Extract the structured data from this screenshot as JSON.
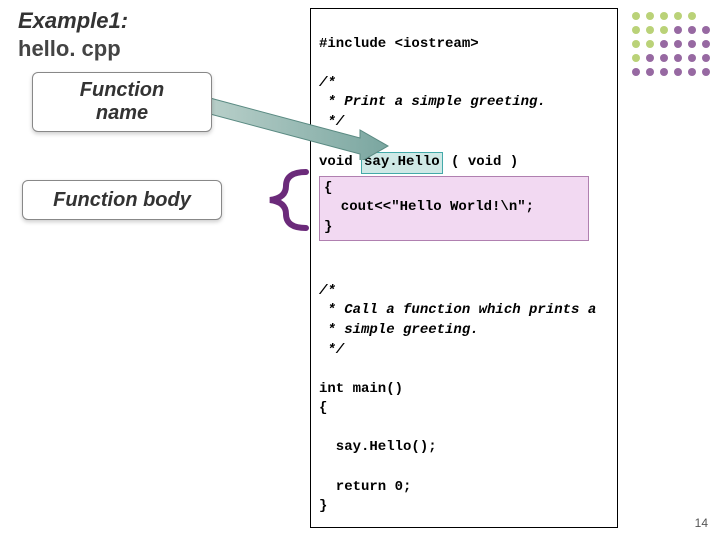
{
  "title": "Example1:",
  "subtitle": "hello. cpp",
  "labels": {
    "function_name": "Function\nname",
    "function_body": "Function body"
  },
  "code": {
    "l1": "#include <iostream>",
    "l2": "",
    "l3": "/*",
    "l4": " * Print a simple greeting.",
    "l5": " */",
    "l6": "",
    "l7a": "void ",
    "fn": "say.Hello",
    "l7b": " ( void )",
    "body_open": "{",
    "body_line": "  cout<<\"Hello World!\\n\";",
    "body_close": "}",
    "l8": "",
    "l9": "/*",
    "l10": " * Call a function which prints a",
    "l11": " * simple greeting.",
    "l12": " */",
    "l13": "",
    "l14": "int main()",
    "l15": "{",
    "l16": "",
    "l17": "  say.Hello();",
    "l18": "",
    "l19": "  return 0;",
    "l20": "}"
  },
  "pagenum": "14",
  "colors": {
    "arrow": "#7aa6a0",
    "brace": "#6b2a7a",
    "dots_green": "#9cbf3f",
    "dots_purple": "#6b2a7a"
  }
}
